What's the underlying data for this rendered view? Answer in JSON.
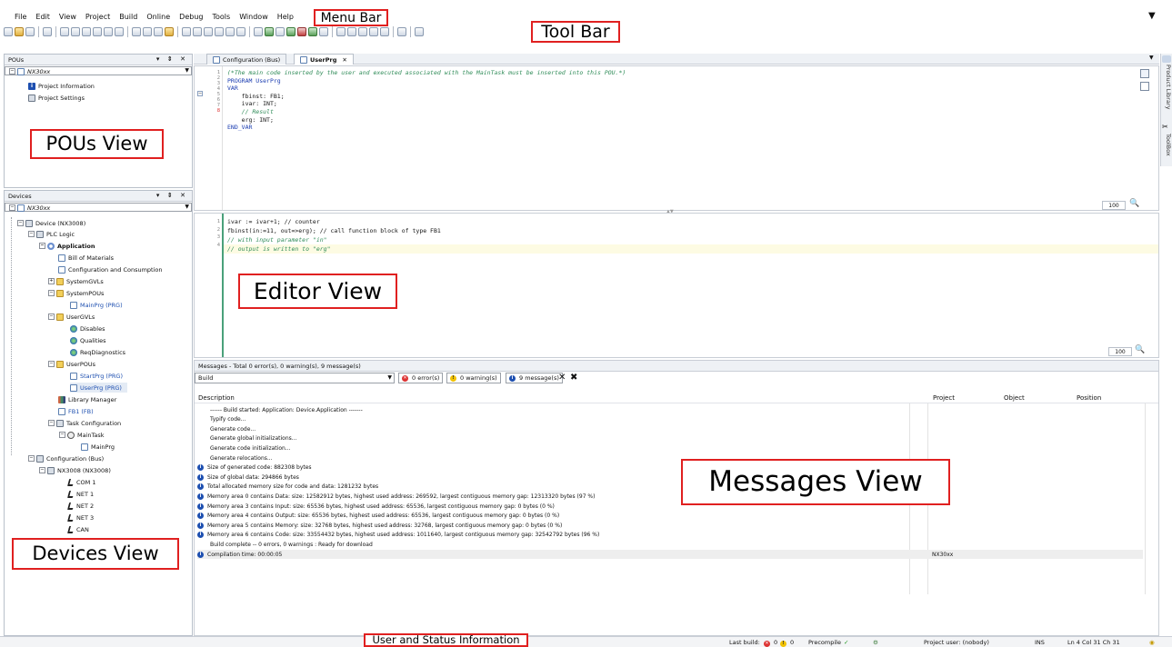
{
  "menu": {
    "items": [
      "File",
      "Edit",
      "View",
      "Project",
      "Build",
      "Online",
      "Debug",
      "Tools",
      "Window",
      "Help"
    ]
  },
  "annotations": {
    "menu_bar": "Menu Bar",
    "tool_bar": "Tool Bar",
    "pous_view": "POUs View",
    "devices_view": "Devices View",
    "editor_view": "Editor View",
    "messages_view": "Messages View",
    "status_info": "User and Status Information"
  },
  "pous": {
    "title": "POUs",
    "root": "NX30xx",
    "items": [
      "Project Information",
      "Project Settings"
    ]
  },
  "devices": {
    "title": "Devices",
    "root": "NX30xx",
    "device": "Device (NX3008)",
    "plc_logic": "PLC Logic",
    "application": "Application",
    "bill": "Bill of Materials",
    "config_consumption": "Configuration and Consumption",
    "system_gvls": "SystemGVLs",
    "system_pous": "SystemPOUs",
    "main_prg": "MainPrg (PRG)",
    "user_gvls": "UserGVLs",
    "disables": "Disables",
    "qualities": "Qualities",
    "req_diag": "ReqDiagnostics",
    "user_pous": "UserPOUs",
    "start_prg": "StartPrg (PRG)",
    "user_prg": "UserPrg (PRG)",
    "library_manager": "Library Manager",
    "fb1": "FB1 (FB)",
    "task_config": "Task Configuration",
    "main_task": "MainTask",
    "main_prg_call": "MainPrg",
    "config_bus": "Configuration (Bus)",
    "nx3008": "NX3008 (NX3008)",
    "com1": "COM 1",
    "net1": "NET 1",
    "net2": "NET 2",
    "net3": "NET 3",
    "can": "CAN"
  },
  "editor": {
    "tabs": [
      "Configuration (Bus)",
      "UserPrg"
    ],
    "decl_lines": [
      "(*The main code inserted by the user and executed associated with the MainTask must be inserted into this POU.*)",
      "PROGRAM UserPrg",
      "VAR",
      "    fbinst: FB1;",
      "    ivar: INT;",
      "    // Result",
      "    erg: INT;",
      "END_VAR"
    ],
    "impl_lines": [
      "ivar := ivar+1; // counter",
      "fbinst(in:=11, out=>erg); // call function block of type FB1",
      "// with input parameter \"in\"",
      "// output is written to \"erg\""
    ],
    "zoom_top": "100",
    "zoom_bottom": "100"
  },
  "messages": {
    "title": "Messages - Total 0 error(s), 0 warning(s), 9 message(s)",
    "filter": "Build",
    "errors_btn": "0 error(s)",
    "warnings_btn": "0 warning(s)",
    "messages_btn": "9 message(s)",
    "columns": [
      "Description",
      "Project",
      "Object",
      "Position"
    ],
    "rows": [
      {
        "icon": false,
        "text": "------ Build started: Application: Device.Application -------",
        "project": ""
      },
      {
        "icon": false,
        "text": "Typify code...",
        "project": ""
      },
      {
        "icon": false,
        "text": "Generate code...",
        "project": ""
      },
      {
        "icon": false,
        "text": "Generate global initializations...",
        "project": ""
      },
      {
        "icon": false,
        "text": "Generate code initialization...",
        "project": ""
      },
      {
        "icon": false,
        "text": "Generate relocations...",
        "project": ""
      },
      {
        "icon": true,
        "text": "Size of generated code: 882308 bytes",
        "project": ""
      },
      {
        "icon": true,
        "text": "Size of global data: 294866 bytes",
        "project": ""
      },
      {
        "icon": true,
        "text": "Total allocated memory size for code and data: 1281232 bytes",
        "project": ""
      },
      {
        "icon": true,
        "text": "Memory area 0 contains  Data: size: 12582912 bytes, highest used address: 269592, largest contiguous memory gap: 12313320 bytes (97 %)",
        "project": ""
      },
      {
        "icon": true,
        "text": "Memory area 3 contains  Input: size: 65536 bytes, highest used address: 65536, largest contiguous memory gap: 0 bytes (0 %)",
        "project": ""
      },
      {
        "icon": true,
        "text": "Memory area 4 contains  Output: size: 65536 bytes, highest used address: 65536, largest contiguous memory gap: 0 bytes (0 %)",
        "project": ""
      },
      {
        "icon": true,
        "text": "Memory area 5 contains  Memory: size: 32768 bytes, highest used address: 32768, largest contiguous memory gap: 0 bytes (0 %)",
        "project": ""
      },
      {
        "icon": true,
        "text": "Memory area 6 contains  Code: size: 33554432 bytes, highest used address: 1011640, largest contiguous memory gap: 32542792 bytes (96 %)",
        "project": ""
      },
      {
        "icon": false,
        "text": "Build complete -- 0 errors, 0 warnings : Ready for download",
        "project": ""
      },
      {
        "icon": true,
        "text": "Compilation time: 00:00:05",
        "project": "NX30xx"
      }
    ]
  },
  "status": {
    "last_build": "Last build:",
    "err_count": "0",
    "warn_count": "0",
    "precompile": "Precompile",
    "project_user": "Project user: (nobody)",
    "ins": "INS",
    "position": "Ln 4  Col 31  Ch 31"
  },
  "side": {
    "product_library": "Product Library",
    "toolbox": "ToolBox"
  }
}
